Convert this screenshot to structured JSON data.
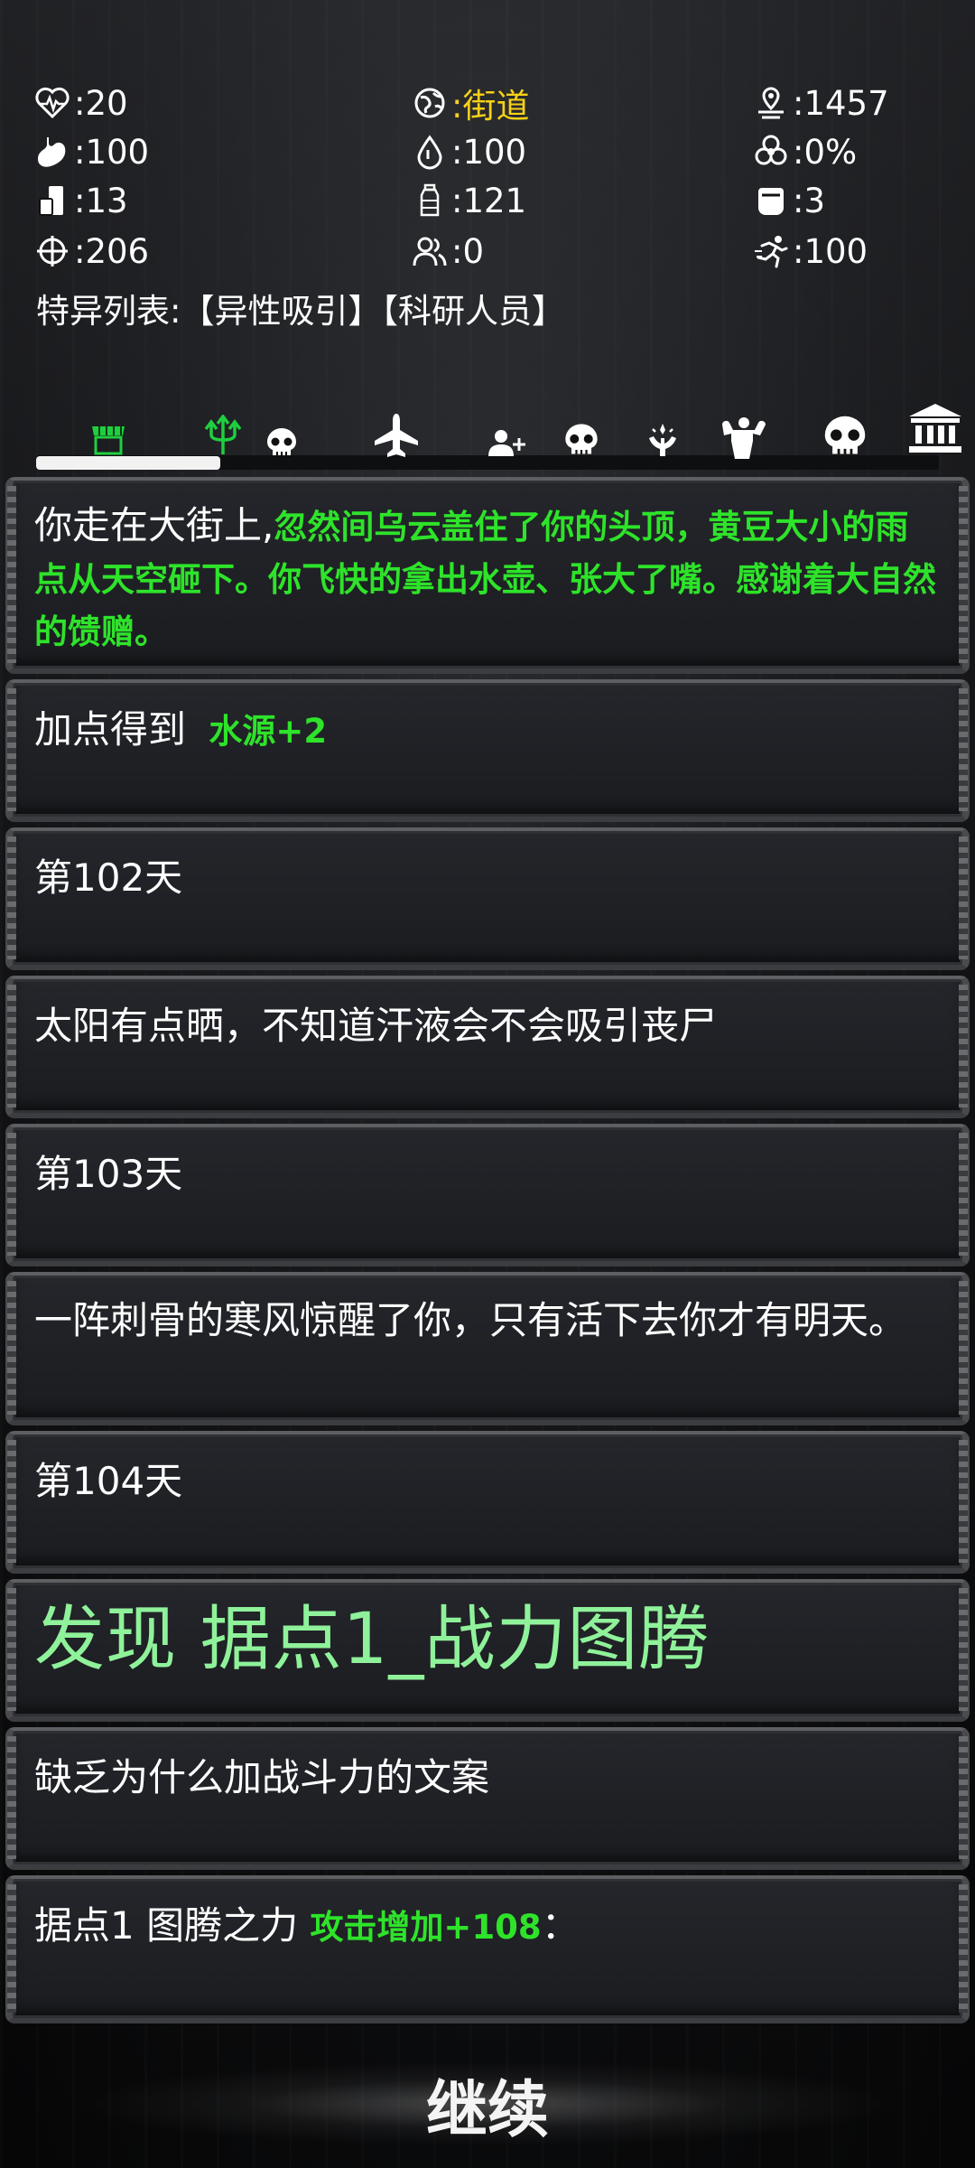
{
  "stats": [
    {
      "icon": "heartbeat-icon",
      "value": ":20"
    },
    {
      "icon": "globe-icon",
      "value": ":街道",
      "highlight": "#f7d117"
    },
    {
      "icon": "location-icon",
      "value": ":1457"
    },
    {
      "icon": "stomach-icon",
      "value": ":100"
    },
    {
      "icon": "water-drop-icon",
      "value": ":100"
    },
    {
      "icon": "biohazard-icon",
      "value": ":0%"
    },
    {
      "icon": "food-can-icon",
      "value": ":13"
    },
    {
      "icon": "water-bottle-icon",
      "value": ":121"
    },
    {
      "icon": "head-icon",
      "value": ":3"
    },
    {
      "icon": "crosshair-icon",
      "value": ":206"
    },
    {
      "icon": "people-icon",
      "value": ":0"
    },
    {
      "icon": "running-icon",
      "value": ":100"
    }
  ],
  "traits": "特异列表:【异性吸引】【科研人员】",
  "tabs": [
    "shop-icon",
    "trident-icon",
    "skull-icon",
    "airplane-icon",
    "add-user-icon",
    "skull-icon",
    "hand-sparkle-icon",
    "strongman-icon",
    "skull-icon",
    "bank-icon"
  ],
  "log": [
    {
      "prefix": "你走在大街上,",
      "highlight": "忽然间乌云盖住了你的头顶，黄豆大小的雨点从天空砸下。你飞快的拿出水壶、张大了嘴。感谢着大自然的馈赠。"
    },
    {
      "prefix": "加点得到 ",
      "highlight": "水源+2"
    },
    {
      "prefix": "第102天"
    },
    {
      "prefix": "太阳有点晒，不知道汗液会不会吸引丧尸"
    },
    {
      "prefix": "第103天"
    },
    {
      "prefix": "一阵刺骨的寒风惊醒了你，只有活下去你才有明天。"
    },
    {
      "prefix": "第104天"
    },
    {
      "big": "发现 据点1_战力图腾"
    },
    {
      "prefix": "缺乏为什么加战斗力的文案"
    },
    {
      "prefix": "据点1 图腾之力 ",
      "highlight": "攻击增加+108",
      "suffix": "："
    }
  ],
  "continue_label": "继续",
  "colors": {
    "accent_green": "#2ee32a",
    "big_green": "#8ff29a",
    "gold": "#f7d117"
  }
}
